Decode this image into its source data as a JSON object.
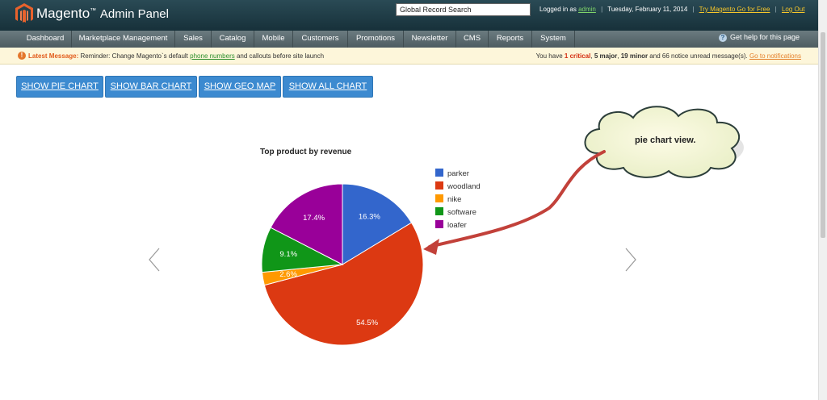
{
  "header": {
    "brand_main": "Magento",
    "brand_sub": "Admin Panel",
    "search_value": "Global Record Search",
    "logged_in_as": "Logged in as",
    "user": "admin",
    "date": "Tuesday, February 11, 2014",
    "try_link": "Try Magento Go for Free",
    "logout": "Log Out"
  },
  "nav": {
    "items": [
      "Dashboard",
      "Marketplace Management",
      "Sales",
      "Catalog",
      "Mobile",
      "Customers",
      "Promotions",
      "Newsletter",
      "CMS",
      "Reports",
      "System"
    ],
    "help": "Get help for this page"
  },
  "message": {
    "label": "Latest Message:",
    "text_before": "Reminder: Change Magento`s default",
    "link": "phone numbers",
    "text_after": "and callouts before site launch",
    "right_prefix": "You have",
    "critical_count": "1 critical",
    "major": "5 major",
    "minor": "19 minor",
    "notice": "66 notice unread message(s).",
    "notif_link": "Go to notifications"
  },
  "buttons": [
    "SHOW PIE CHART",
    "SHOW BAR CHART",
    "SHOW GEO MAP",
    "SHOW ALL CHART"
  ],
  "callout": "pie chart view.",
  "colors": {
    "header": "#1d3a45",
    "accent": "#3c8ad0"
  },
  "chart_data": {
    "type": "pie",
    "title": "Top product by revenue",
    "categories": [
      "parker",
      "woodland",
      "nike",
      "software",
      "loafer"
    ],
    "values": [
      16.3,
      54.5,
      2.6,
      9.1,
      17.4
    ],
    "labels": [
      "16.3%",
      "54.5%",
      "2.6%",
      "9.1%",
      "17.4%"
    ],
    "colors": [
      "#3366cc",
      "#dc3912",
      "#ff9900",
      "#109618",
      "#990099"
    ],
    "legend_position": "right"
  }
}
